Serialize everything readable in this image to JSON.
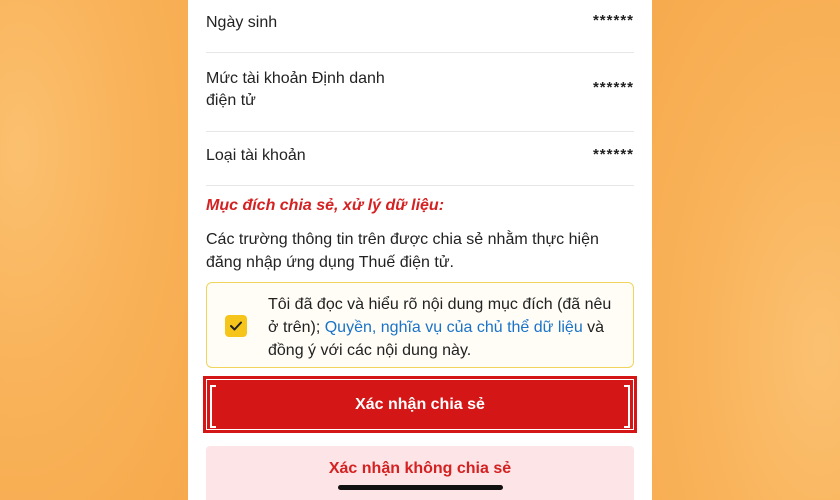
{
  "info_rows": [
    {
      "label": "Ngày sinh",
      "value": "******"
    },
    {
      "label": "Mức tài khoản Định danh điện tử",
      "value": "******"
    },
    {
      "label": "Loại tài khoản",
      "value": "******"
    }
  ],
  "purpose": {
    "title": "Mục đích chia sẻ, xử lý dữ liệu:",
    "text": "Các trường thông tin trên được chia sẻ nhằm thực hiện đăng nhập ứng dụng Thuế điện tử."
  },
  "consent": {
    "checked": true,
    "text_before": "Tôi đã đọc và hiểu rõ nội dung mục đích (đã nêu ở trên); ",
    "link_text": "Quyền, nghĩa vụ của chủ thể dữ liệu",
    "text_after": " và đồng ý với các nội dung này."
  },
  "buttons": {
    "confirm_label": "Xác nhận chia sẻ",
    "deny_label": "Xác nhận không chia sẻ"
  },
  "colors": {
    "accent_red": "#d51617",
    "checkbox_yellow": "#f6c51b",
    "link_blue": "#1a73c8",
    "background_orange": "#f9b45d"
  }
}
